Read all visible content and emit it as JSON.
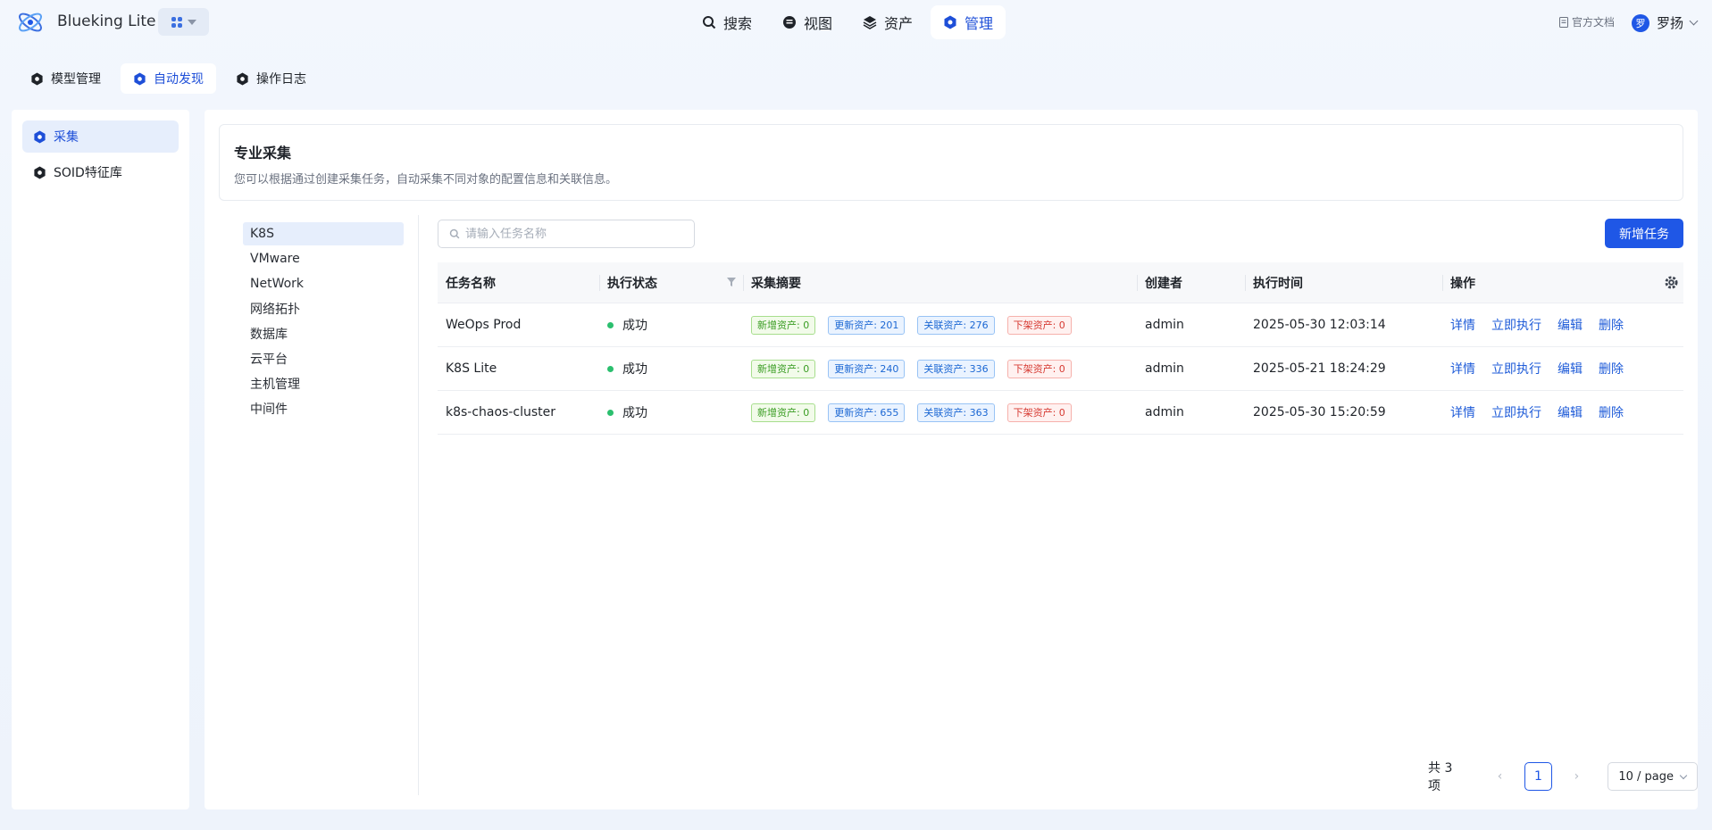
{
  "app": {
    "title": "Blueking Lite"
  },
  "nav": [
    {
      "label": "搜索",
      "icon": "search-icon"
    },
    {
      "label": "视图",
      "icon": "view-icon"
    },
    {
      "label": "资产",
      "icon": "layers-icon"
    },
    {
      "label": "管理",
      "icon": "manage-icon",
      "active": true
    }
  ],
  "header": {
    "doc_link": "官方文档",
    "user_initial": "罗",
    "user_name": "罗扬"
  },
  "subtabs": [
    {
      "label": "模型管理"
    },
    {
      "label": "自动发现",
      "active": true
    },
    {
      "label": "操作日志"
    }
  ],
  "leftmenu": [
    {
      "label": "采集",
      "active": true
    },
    {
      "label": "SOID特征库"
    }
  ],
  "intro": {
    "title": "专业采集",
    "desc": "您可以根据通过创建采集任务，自动采集不同对象的配置信息和关联信息。"
  },
  "categories": [
    "K8S",
    "VMware",
    "NetWork",
    "网络拓扑",
    "数据库",
    "云平台",
    "主机管理",
    "中间件"
  ],
  "search": {
    "placeholder": "请输入任务名称"
  },
  "add_button": "新增任务",
  "table": {
    "headers": {
      "name": "任务名称",
      "status": "执行状态",
      "summary": "采集摘要",
      "creator": "创建者",
      "time": "执行时间",
      "ops": "操作"
    },
    "rows": [
      {
        "name": "WeOps Prod",
        "status": "成功",
        "tags": [
          "新增资产: 0",
          "更新资产: 201",
          "关联资产: 276",
          "下架资产: 0"
        ],
        "creator": "admin",
        "time": "2025-05-30 12:03:14",
        "ops": [
          "详情",
          "立即执行",
          "编辑",
          "删除"
        ]
      },
      {
        "name": "K8S Lite",
        "status": "成功",
        "tags": [
          "新增资产: 0",
          "更新资产: 240",
          "关联资产: 336",
          "下架资产: 0"
        ],
        "creator": "admin",
        "time": "2025-05-21 18:24:29",
        "ops": [
          "详情",
          "立即执行",
          "编辑",
          "删除"
        ]
      },
      {
        "name": "k8s-chaos-cluster",
        "status": "成功",
        "tags": [
          "新增资产: 0",
          "更新资产: 655",
          "关联资产: 363",
          "下架资产: 0"
        ],
        "creator": "admin",
        "time": "2025-05-30 15:20:59",
        "ops": [
          "详情",
          "立即执行",
          "编辑",
          "删除"
        ]
      }
    ]
  },
  "pagination": {
    "total": "共 3 项",
    "current": "1",
    "page_size": "10 / page"
  },
  "colors": {
    "primary": "#1f57e6",
    "success": "#2bbf6e"
  }
}
